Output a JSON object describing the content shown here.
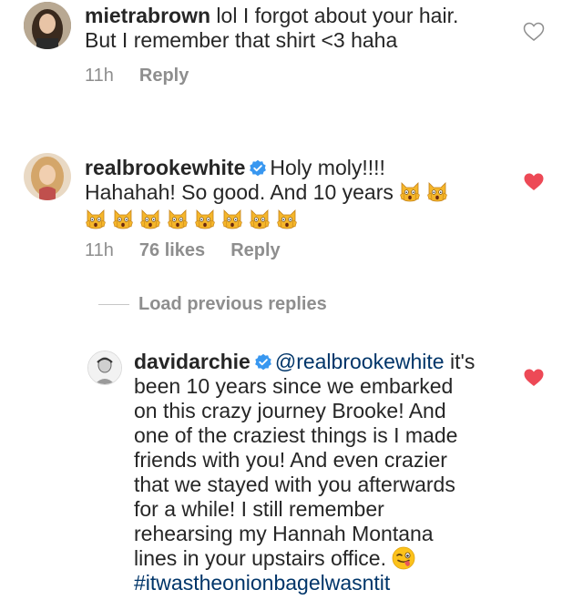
{
  "comments": [
    {
      "username": "mietrabrown",
      "verified": false,
      "lines": [
        "lol I forgot about your hair.",
        "But I remember that shirt <3 haha"
      ],
      "time": "11h",
      "likes": "",
      "reply_label": "Reply",
      "liked": false
    },
    {
      "username": "realbrookewhite",
      "verified": true,
      "line1": "Holy moly!!!!",
      "line2": "Hahahah! So good. And 10 years",
      "emoji_name": "scream-cat-emoji",
      "time": "11h",
      "likes": "76 likes",
      "reply_label": "Reply",
      "liked": true
    }
  ],
  "load_previous": "Load previous replies",
  "reply": {
    "username": "davidarchie",
    "verified": true,
    "mention": "@realbrookewhite",
    "lines": [
      "it's",
      "been 10 years since we embarked",
      "on this crazy journey Brooke! And",
      "one of the craziest things is I made",
      "friends with you!  And even crazier",
      "that we stayed with you afterwards",
      "for a while! I still remember",
      "rehearsing my Hannah Montana",
      "lines in your upstairs office."
    ],
    "hashtag": "#itwastheonionbagelwasntit",
    "emoji_name": "winking-face-tongue-emoji",
    "liked": true
  },
  "colors": {
    "text": "#262626",
    "meta": "#8e8e8e",
    "link": "#003569",
    "like": "#ed4956",
    "verified": "#3897f0"
  }
}
